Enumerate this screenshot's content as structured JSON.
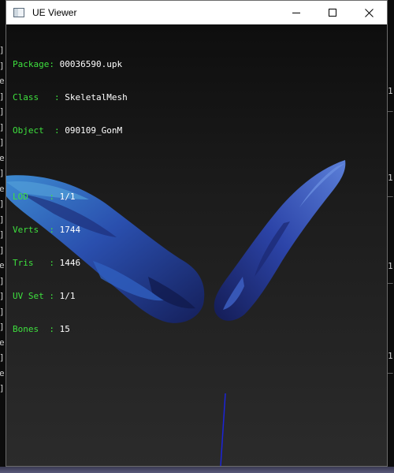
{
  "window": {
    "title": "UE Viewer"
  },
  "info": {
    "rows": [
      {
        "label": "Package: ",
        "value": "00036590.upk"
      },
      {
        "label": "Class   : ",
        "value": "SkeletalMesh"
      },
      {
        "label": "Object  : ",
        "value": "090109_GonM"
      }
    ],
    "stats": [
      {
        "label": "LOD    : ",
        "value": "1/1"
      },
      {
        "label": "Verts  : ",
        "value": "1744"
      },
      {
        "label": "Tris   : ",
        "value": "1446"
      },
      {
        "label": "UV Set : ",
        "value": "1/1"
      },
      {
        "label": "Bones  : ",
        "value": "15"
      }
    ]
  },
  "colors": {
    "label": "#3ee03e",
    "value": "#ffffff",
    "wing_dark": "#1b2a6b",
    "wing_light": "#4a90d0"
  },
  "background_terminal": {
    "left_marks": [
      "]",
      "]",
      "e",
      "]",
      "]",
      "]",
      "]",
      "e",
      "]",
      "e",
      "]",
      "]",
      "]",
      "]",
      "e",
      "]",
      "]",
      "]",
      "]",
      "e",
      "]",
      "e",
      "]"
    ],
    "right_marks": [
      "1",
      "_",
      "1",
      "_",
      "1",
      "_",
      "1",
      "_"
    ]
  }
}
